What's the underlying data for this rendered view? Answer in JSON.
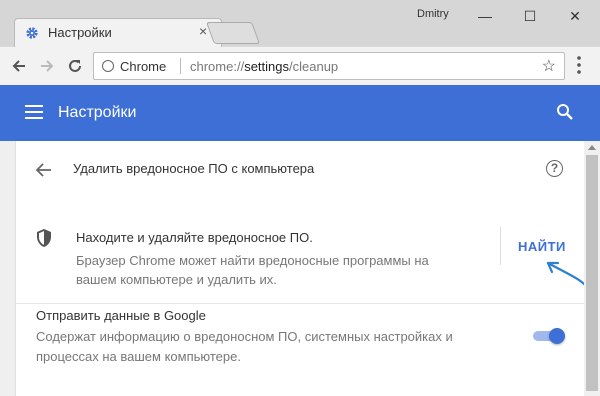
{
  "window": {
    "tab_title": "Настройки",
    "tab_close": "×",
    "user_name": "Dmitry",
    "minimize": "—",
    "maximize": "☐",
    "close": "✕"
  },
  "toolbar": {
    "site_chip": "Chrome",
    "url_scheme": "chrome://",
    "url_path": "settings",
    "url_rest": "/cleanup",
    "star": "☆"
  },
  "header": {
    "title": "Настройки"
  },
  "page": {
    "title": "Удалить вредоносное ПО с компьютера",
    "help": "?",
    "find": {
      "title": "Находите и удаляйте вредоносное ПО.",
      "description": "Браузер Chrome может найти вредоносные программы на вашем компьютере и удалить их.",
      "button": "НАЙТИ"
    },
    "report": {
      "title": "Отправить данные в Google",
      "description": "Содержат информацию о вредоносном ПО, системных настройках и процессах на вашем компьютере.",
      "enabled": true
    }
  },
  "colors": {
    "accent": "#3d6fd6",
    "annotation_arrow": "#2f7fd0"
  }
}
